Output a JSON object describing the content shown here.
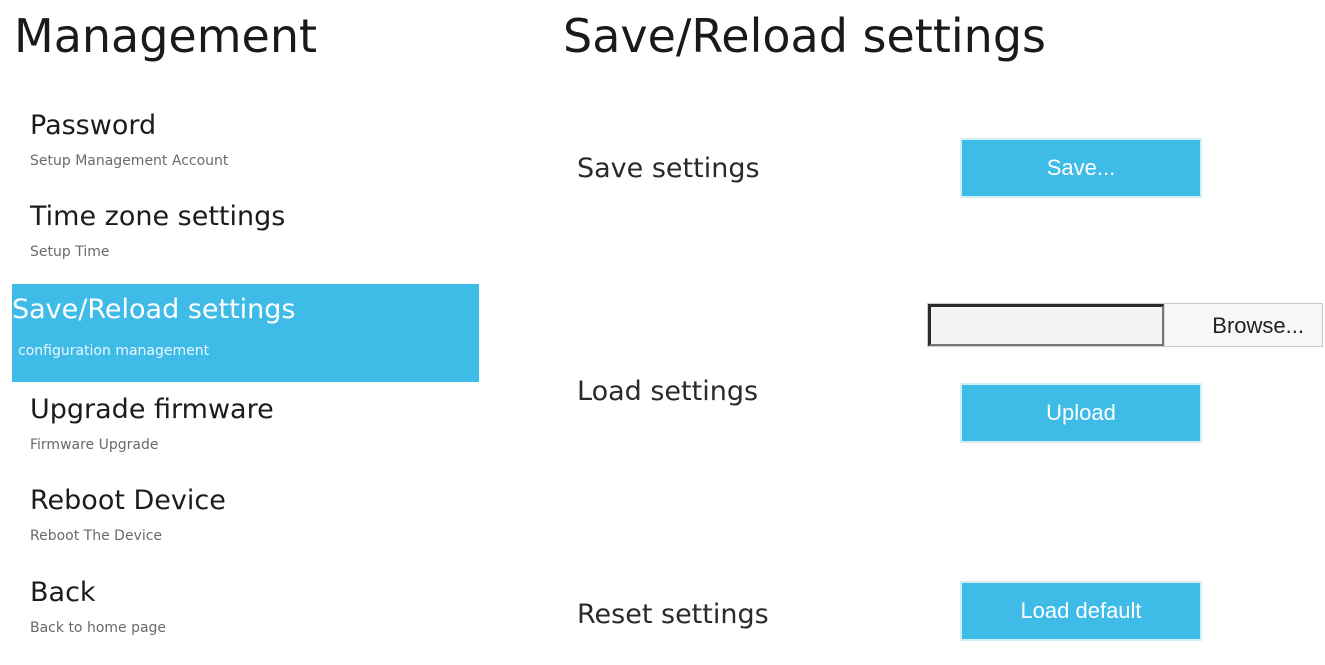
{
  "sidebar": {
    "title": "Management",
    "items": [
      {
        "label": "Password",
        "sub": "Setup Management Account"
      },
      {
        "label": "Time zone settings",
        "sub": "Setup Time"
      },
      {
        "label": "Save/Reload settings",
        "sub": "configuration management",
        "active": true
      },
      {
        "label": "Upgrade firmware",
        "sub": "Firmware Upgrade"
      },
      {
        "label": "Reboot Device",
        "sub": "Reboot The Device"
      },
      {
        "label": "Back",
        "sub": "Back to home page"
      }
    ]
  },
  "main": {
    "title": "Save/Reload settings",
    "save": {
      "label": "Save settings",
      "button": "Save..."
    },
    "load": {
      "label": "Load settings",
      "file_value": "",
      "browse": "Browse...",
      "button": "Upload"
    },
    "reset": {
      "label": "Reset settings",
      "button": "Load default"
    }
  },
  "colors": {
    "accent": "#3fbbe8",
    "button_text": "#ffffff",
    "sub_text": "#6a6a6a"
  }
}
